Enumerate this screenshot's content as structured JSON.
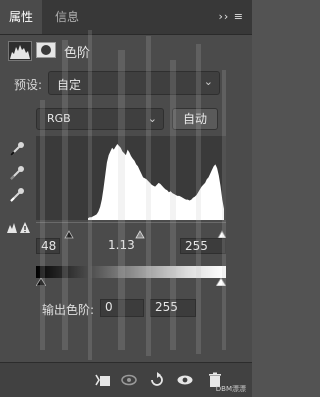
{
  "tabs": {
    "properties": "属性",
    "info": "信息",
    "menu": "›› ≡"
  },
  "header": {
    "title": "色阶"
  },
  "preset": {
    "label": "预设:",
    "value": "自定"
  },
  "channel": {
    "value": "RGB"
  },
  "auto_button": {
    "label": "自动"
  },
  "input_levels": {
    "black": "48",
    "gamma": "1.13",
    "white": "255"
  },
  "output_levels": {
    "label": "输出色阶:",
    "black": "0",
    "white": "255"
  },
  "watermark": "DBM漂漂",
  "icons": {
    "close": "close-icon",
    "menu": "panel-menu-icon",
    "levels": "levels-icon",
    "mask": "mask-icon",
    "chevron": "chevron-down-icon",
    "black_dropper": "eyedropper-black-icon",
    "gray_dropper": "eyedropper-gray-icon",
    "white_dropper": "eyedropper-white-icon",
    "warning": "clipping-warning-icon",
    "clip": "clip-to-layer-icon",
    "view_previous": "view-previous-icon",
    "reset": "reset-icon",
    "visibility": "eye-icon",
    "delete": "trash-icon"
  },
  "histogram": {
    "levels_shown": [
      2,
      3,
      3,
      4,
      5,
      6,
      9,
      14,
      22,
      34,
      48,
      62,
      70,
      74,
      78,
      76,
      79,
      82,
      80,
      78,
      74,
      72,
      70,
      76,
      73,
      69,
      66,
      64,
      60,
      58,
      54,
      50,
      46,
      45,
      44,
      42,
      40,
      38,
      37,
      36,
      38,
      40,
      39,
      37,
      35,
      33,
      32,
      30,
      31,
      29,
      28,
      27,
      26,
      26,
      25,
      24,
      23,
      22,
      22,
      21,
      22,
      24,
      25,
      27,
      30,
      33,
      36,
      38,
      40,
      44,
      46,
      50,
      54,
      58,
      60,
      56,
      48,
      36,
      22,
      12
    ]
  }
}
